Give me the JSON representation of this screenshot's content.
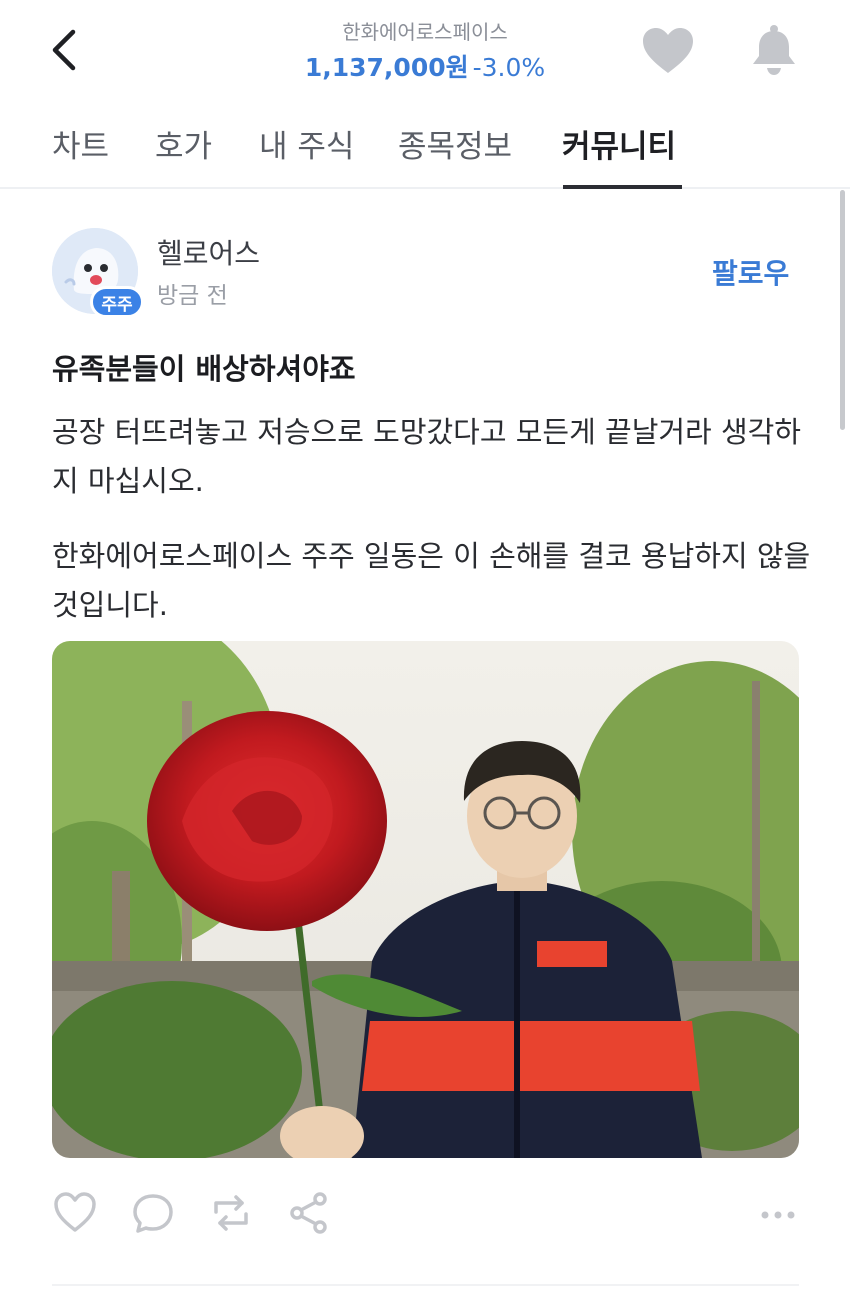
{
  "header": {
    "stock_name": "한화에어로스페이스",
    "price": "1,137,000원",
    "change": "-3.0%"
  },
  "tabs": [
    {
      "label": "차트"
    },
    {
      "label": "호가"
    },
    {
      "label": "내 주식"
    },
    {
      "label": "종목정보"
    },
    {
      "label": "커뮤니티",
      "active": true
    }
  ],
  "post": {
    "author": "헬로어스",
    "badge": "주주",
    "time": "방금 전",
    "follow_label": "팔로우",
    "title": "유족분들이 배상하셔야죠",
    "paragraphs": [
      "공장 터뜨려놓고 저승으로 도망갔다고 모든게 끝날거라 생각하지 마십시오.",
      "한화에어로스페이스 주주 일동은 이 손해를 결코 용납하지 않을 것입니다."
    ]
  },
  "icons": {
    "back": "chevron-left-icon",
    "favorite": "heart-icon",
    "notification": "bell-icon",
    "like": "heart-outline-icon",
    "comment": "comment-icon",
    "repost": "repost-icon",
    "share": "share-icon",
    "more": "more-horizontal-icon"
  },
  "colors": {
    "accent": "#3a7bd5",
    "badge": "#3b82e6",
    "icon_gray": "#c4c6cb"
  }
}
